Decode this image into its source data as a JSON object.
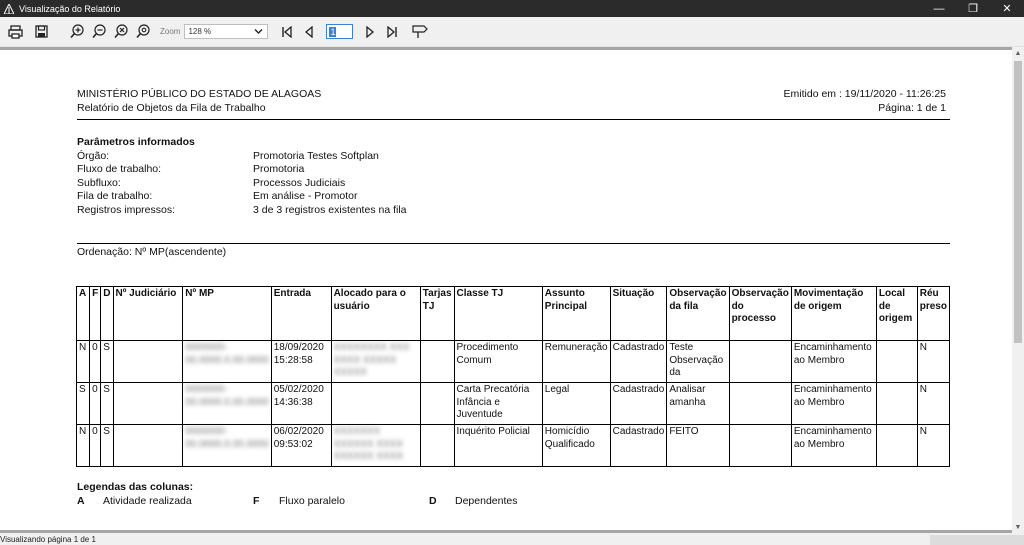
{
  "window": {
    "title": "Visualização do Relatório"
  },
  "toolbar": {
    "zoom_label": "Zoom",
    "zoom_value": "128 %",
    "page_number": "1"
  },
  "report": {
    "org": "MINISTÉRIO PÚBLICO DO ESTADO DE ALAGOAS",
    "subtitle": "Relatório de Objetos da Fila de Trabalho",
    "emitted": "Emitido em : 19/11/2020 - 11:26:25",
    "page_info": "Página: 1 de 1",
    "params_title": "Parâmetros informados",
    "params": [
      {
        "label": "Órgão:",
        "value": "Promotoria Testes Softplan"
      },
      {
        "label": "Fluxo de trabalho:",
        "value": "Promotoria"
      },
      {
        "label": "Subfluxo:",
        "value": "Processos Judiciais"
      },
      {
        "label": "Fila de trabalho:",
        "value": "Em análise - Promotor"
      },
      {
        "label": "Registros impressos:",
        "value": "3 de 3 registros existentes na fila"
      }
    ],
    "ordering": "Ordenação: Nº MP(ascendente)",
    "columns": [
      "A",
      "F",
      "D",
      "Nº Judiciário",
      "Nº MP",
      "Entrada",
      "Alocado para o usuário",
      "Tarjas TJ",
      "Classe TJ",
      "Assunto Principal",
      "Situação",
      "Observação da fila",
      "Observação do processo",
      "Movimentação de origem",
      "Local de origem",
      "Réu preso"
    ],
    "rows": [
      {
        "a": "N",
        "f": "0",
        "d": "S",
        "judiciario": "",
        "mp": "0000000-00.0000.0.00.0000",
        "entrada": "18/09/2020 15:28:58",
        "alocado": "XXXXXXXX XXX XXXX XXXXX XXXXX",
        "tarjas": "",
        "classe": "Procedimento Comum",
        "assunto": "Remuneração",
        "situacao": "Cadastrado",
        "obs_fila": "Teste Observação da",
        "obs_proc": "",
        "mov": "Encaminhamento ao Membro",
        "local": "",
        "reu": "N"
      },
      {
        "a": "S",
        "f": "0",
        "d": "S",
        "judiciario": "",
        "mp": "0000000-00.0000.0.00.0000",
        "entrada": "05/02/2020 14:36:38",
        "alocado": "",
        "tarjas": "",
        "classe": "Carta Precatória Infância e Juventude",
        "assunto": "Legal",
        "situacao": "Cadastrado",
        "obs_fila": "Analisar amanha",
        "obs_proc": "",
        "mov": "Encaminhamento ao Membro",
        "local": "",
        "reu": "N"
      },
      {
        "a": "N",
        "f": "0",
        "d": "S",
        "judiciario": "",
        "mp": "0000000-00.0000.0.00.0000",
        "entrada": "06/02/2020 09:53:02",
        "alocado": "XXXXXXX XXXXXX XXXX XXXXXX XXXX",
        "tarjas": "",
        "classe": "Inquérito Policial",
        "assunto": "Homicídio Qualificado",
        "situacao": "Cadastrado",
        "obs_fila": "FEITO",
        "obs_proc": "",
        "mov": "Encaminhamento ao Membro",
        "local": "",
        "reu": "N"
      }
    ],
    "legend_title": "Legendas das colunas:",
    "legend": [
      {
        "code": "A",
        "desc": "Atividade realizada"
      },
      {
        "code": "F",
        "desc": "Fluxo paralelo"
      },
      {
        "code": "D",
        "desc": "Dependentes"
      }
    ]
  },
  "status": {
    "text": "Visualizando página 1 de 1"
  }
}
